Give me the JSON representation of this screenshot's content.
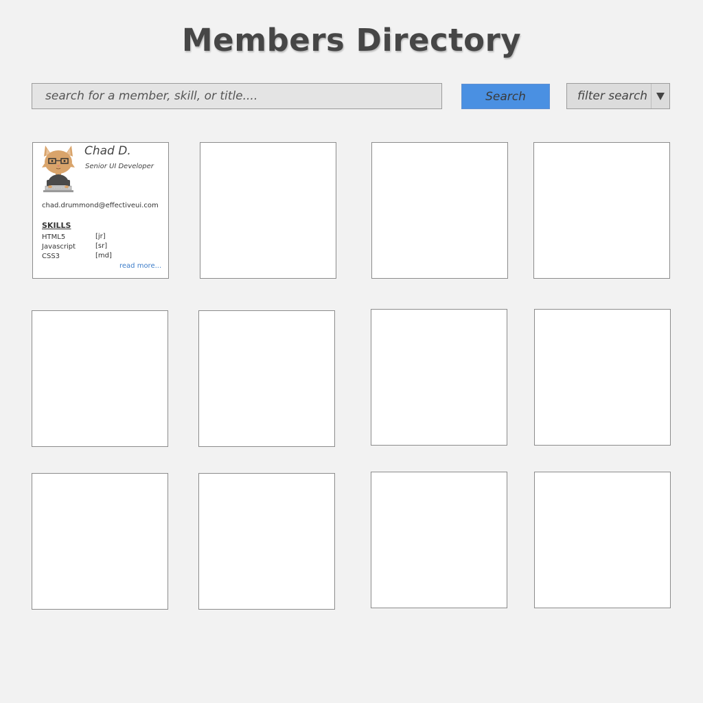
{
  "header": {
    "title": "Members Directory"
  },
  "search": {
    "placeholder": "search for a member, skill, or title....",
    "value": "",
    "button_label": "Search",
    "filter_label": "filter search",
    "filter_icon": "triangle-down-icon"
  },
  "colors": {
    "background": "#f2f2f2",
    "accent": "#4a90e2",
    "link": "#3a7bc8"
  },
  "members": [
    {
      "name": "Chad D.",
      "title": "Senior UI Developer",
      "email": "chad.drummond@effectiveui.com",
      "avatar_icon": "cat-developer-avatar-icon",
      "skills_heading": "SKILLS",
      "skills": [
        {
          "name": "HTML5",
          "level": "[jr]"
        },
        {
          "name": "Javascript",
          "level": "[sr]"
        },
        {
          "name": "CSS3",
          "level": "[md]"
        }
      ],
      "read_more": "read more..."
    }
  ]
}
